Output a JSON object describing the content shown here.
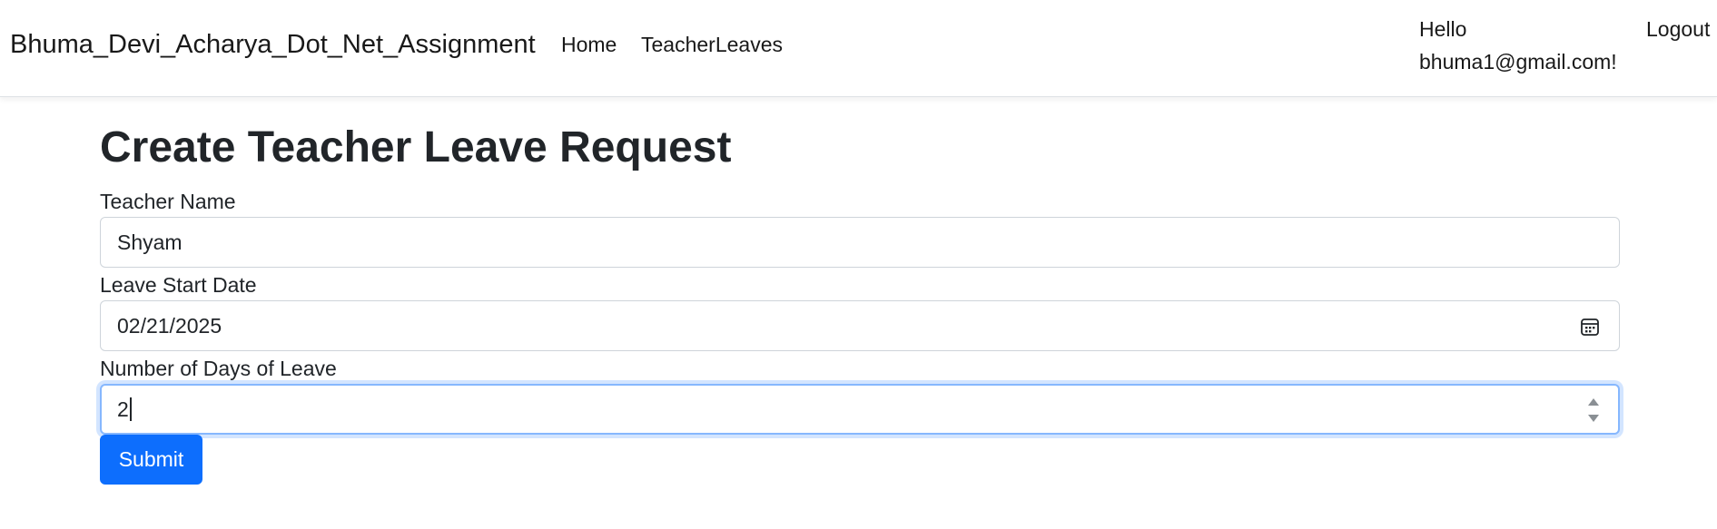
{
  "navbar": {
    "brand": "Bhuma_Devi_Acharya_Dot_Net_Assignment",
    "links": [
      {
        "label": "Home"
      },
      {
        "label": "TeacherLeaves"
      }
    ],
    "greeting_line1": "Hello",
    "greeting_line2": "bhuma1@gmail.com!",
    "logout": "Logout"
  },
  "page": {
    "title": "Create Teacher Leave Request"
  },
  "form": {
    "teacher_name": {
      "label": "Teacher Name",
      "value": "Shyam"
    },
    "leave_start_date": {
      "label": "Leave Start Date",
      "value": "02/21/2025"
    },
    "days_of_leave": {
      "label": "Number of Days of Leave",
      "value": "2"
    },
    "submit_label": "Submit"
  },
  "colors": {
    "primary": "#0d6efd",
    "focus_border": "#86b7fe",
    "text": "#212529",
    "input_border": "#ced4da"
  },
  "icons": {
    "date_picker": "calendar-icon",
    "number_spinner": "spinner-arrows-icon"
  }
}
